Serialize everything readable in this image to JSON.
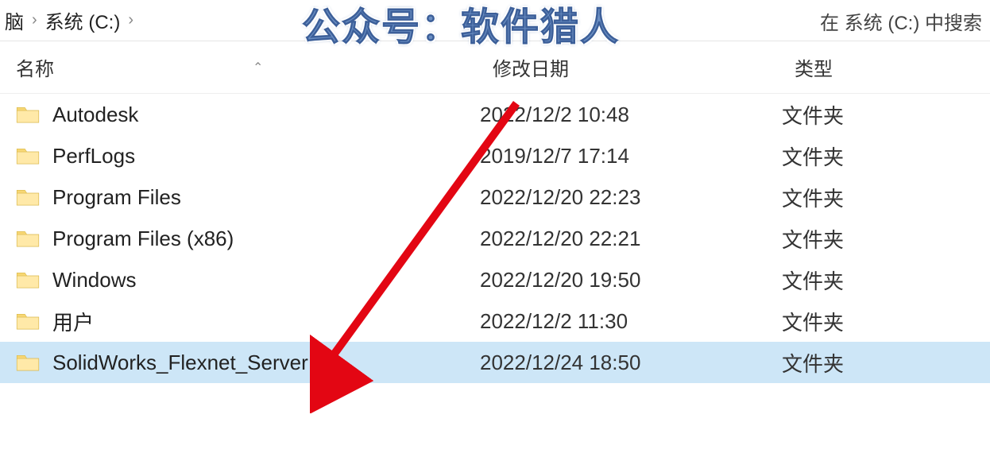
{
  "breadcrumb": {
    "item0": "脑",
    "item1": "系统 (C:)"
  },
  "search": {
    "placeholder": "在 系统 (C:) 中搜索"
  },
  "watermark": "公众号：软件猎人",
  "columns": {
    "name": "名称",
    "date": "修改日期",
    "type": "类型"
  },
  "rows": [
    {
      "name": "Autodesk",
      "date": "2022/12/2 10:48",
      "type": "文件夹"
    },
    {
      "name": "PerfLogs",
      "date": "2019/12/7 17:14",
      "type": "文件夹"
    },
    {
      "name": "Program Files",
      "date": "2022/12/20 22:23",
      "type": "文件夹"
    },
    {
      "name": "Program Files (x86)",
      "date": "2022/12/20 22:21",
      "type": "文件夹"
    },
    {
      "name": "Windows",
      "date": "2022/12/20 19:50",
      "type": "文件夹"
    },
    {
      "name": "用户",
      "date": "2022/12/2 11:30",
      "type": "文件夹"
    },
    {
      "name": "SolidWorks_Flexnet_Server",
      "date": "2022/12/24 18:50",
      "type": "文件夹"
    }
  ],
  "selected_index": 6
}
